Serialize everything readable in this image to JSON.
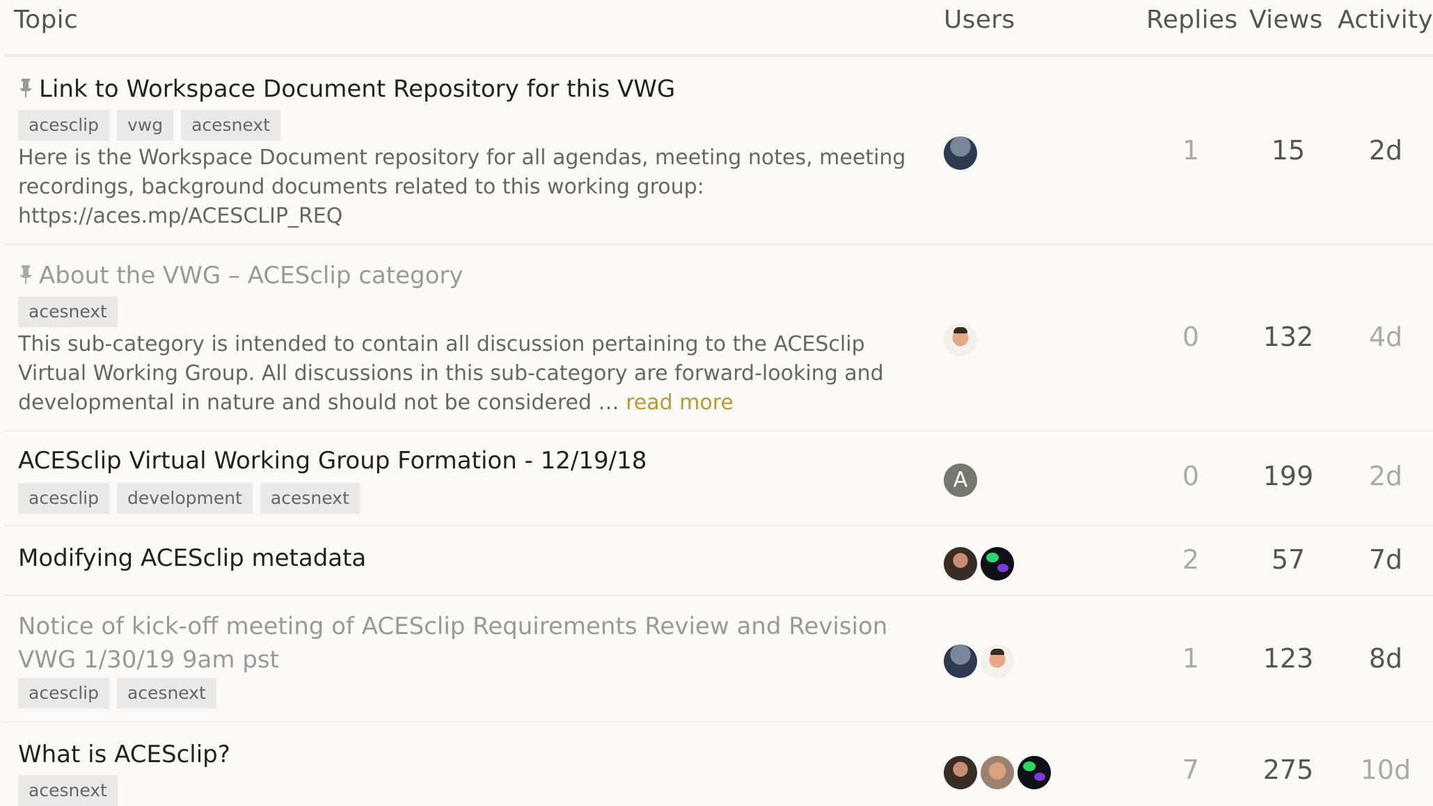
{
  "header": {
    "topic": "Topic",
    "users": "Users",
    "replies": "Replies",
    "views": "Views",
    "activity": "Activity"
  },
  "topics": [
    {
      "title": "Link to Workspace Document Repository for this VWG",
      "pinned": true,
      "visited": false,
      "tags": [
        "acesclip",
        "vwg",
        "acesnext"
      ],
      "excerpt": "Here is the Workspace Document repository for all agendas, meeting notes, meeting recordings, background documents related to this working group: https://aces.mp/ACESCLIP_REQ",
      "avatars": [
        "dark-avatar"
      ],
      "replies": "1",
      "views": "15",
      "activity": "2d"
    },
    {
      "title": "About the VWG – ACESclip category",
      "pinned": true,
      "visited": true,
      "tags": [
        "acesnext"
      ],
      "excerpt": "This sub-category is intended to contain all discussion pertaining to the ACESclip Virtual Working Group. All discussions in this sub-category are forward-looking and developmental in nature and should not be considered …",
      "read_more": "read more",
      "avatars": [
        "face-avatar"
      ],
      "replies": "0",
      "views": "132",
      "activity": "4d"
    },
    {
      "title": "ACESclip Virtual Working Group Formation - 12/19/18",
      "pinned": false,
      "visited": false,
      "tags": [
        "acesclip",
        "development",
        "acesnext"
      ],
      "avatars": [
        "letter-avatar"
      ],
      "avatar_letter": "A",
      "replies": "0",
      "views": "199",
      "activity": "2d"
    },
    {
      "title": "Modifying ACESclip metadata",
      "pinned": false,
      "visited": false,
      "tags": [],
      "avatars": [
        "beard-avatar",
        "splash-avatar"
      ],
      "replies": "2",
      "views": "57",
      "activity": "7d"
    },
    {
      "title": "Notice of kick-off meeting of ACESclip Requirements Review and Revision VWG 1/30/19 9am pst",
      "pinned": false,
      "visited": true,
      "tags": [
        "acesclip",
        "acesnext"
      ],
      "avatars": [
        "dark-avatar",
        "face-avatar"
      ],
      "replies": "1",
      "views": "123",
      "activity": "8d"
    },
    {
      "title": "What is ACESclip?",
      "pinned": false,
      "visited": false,
      "tags": [
        "acesnext"
      ],
      "avatars": [
        "beard-avatar",
        "elder-avatar",
        "splash-avatar"
      ],
      "replies": "7",
      "views": "275",
      "activity": "10d"
    }
  ],
  "colors": {
    "background": "#fbfaf9",
    "tag_background": "#e9e9e9",
    "read_more": "#b89a2a",
    "muted_text": "#999999"
  }
}
